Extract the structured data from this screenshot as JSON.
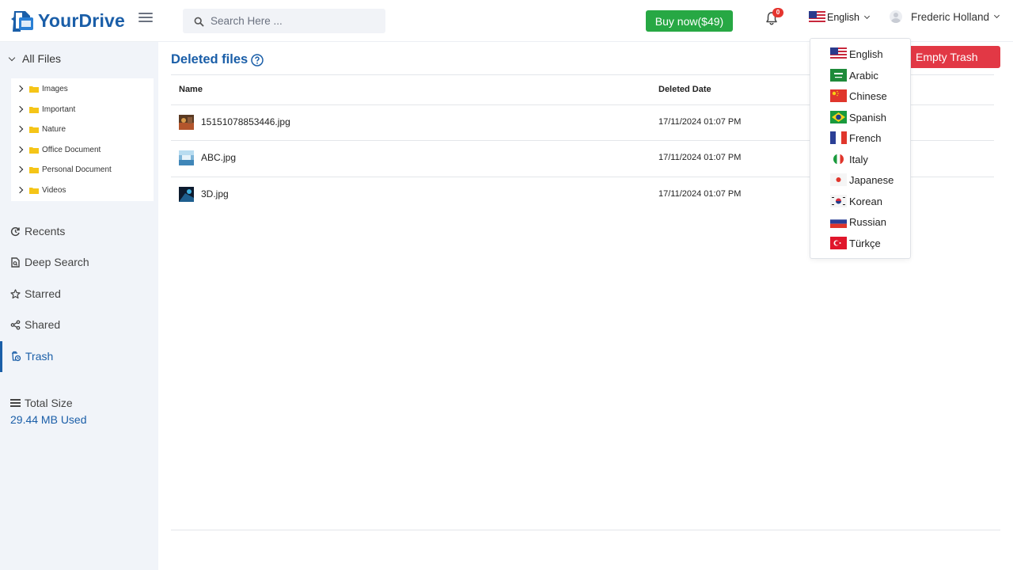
{
  "app": {
    "name": "YourDrive"
  },
  "header": {
    "search_placeholder": "Search Here ...",
    "buy_label": "Buy now($49)",
    "notification_count": "0",
    "language": "English",
    "user_name": "Frederic Holland"
  },
  "sidebar": {
    "all_files_label": "All Files",
    "folders": [
      {
        "label": "Images"
      },
      {
        "label": "Important"
      },
      {
        "label": "Nature"
      },
      {
        "label": "Office Document"
      },
      {
        "label": "Personal Document"
      },
      {
        "label": "Videos"
      }
    ],
    "nav": [
      {
        "label": "Recents",
        "icon": "history-icon"
      },
      {
        "label": "Deep Search",
        "icon": "file-search-icon"
      },
      {
        "label": "Starred",
        "icon": "star-icon"
      },
      {
        "label": "Shared",
        "icon": "share-icon"
      },
      {
        "label": "Trash",
        "icon": "trash-icon",
        "active": true
      }
    ],
    "total_size_label": "Total Size",
    "used_label": "29.44 MB Used"
  },
  "main": {
    "title": "Deleted files",
    "empty_trash_label": "Empty Trash",
    "columns": [
      "Name",
      "Deleted Date"
    ],
    "rows": [
      {
        "name": "15151078853446.jpg",
        "deleted": "17/11/2024 01:07 PM"
      },
      {
        "name": "ABC.jpg",
        "deleted": "17/11/2024 01:07 PM"
      },
      {
        "name": "3D.jpg",
        "deleted": "17/11/2024 01:07 PM"
      }
    ]
  },
  "language_menu": {
    "items": [
      {
        "label": "English",
        "flag": "us-flag-icon"
      },
      {
        "label": "Arabic",
        "flag": "saudi-flag-icon"
      },
      {
        "label": "Chinese",
        "flag": "china-flag-icon"
      },
      {
        "label": "Spanish",
        "flag": "brazil-flag-icon"
      },
      {
        "label": "French",
        "flag": "france-flag-icon"
      },
      {
        "label": "Italy",
        "flag": "italy-flag-icon"
      },
      {
        "label": "Japanese",
        "flag": "japan-flag-icon"
      },
      {
        "label": "Korean",
        "flag": "korea-flag-icon"
      },
      {
        "label": "Russian",
        "flag": "russia-flag-icon"
      },
      {
        "label": "Türkçe",
        "flag": "turkey-flag-icon"
      }
    ]
  },
  "colors": {
    "brand": "#1a5ea8",
    "buy_button": "#27a844",
    "danger": "#e23845",
    "sidebar_bg": "#f1f4f9"
  }
}
